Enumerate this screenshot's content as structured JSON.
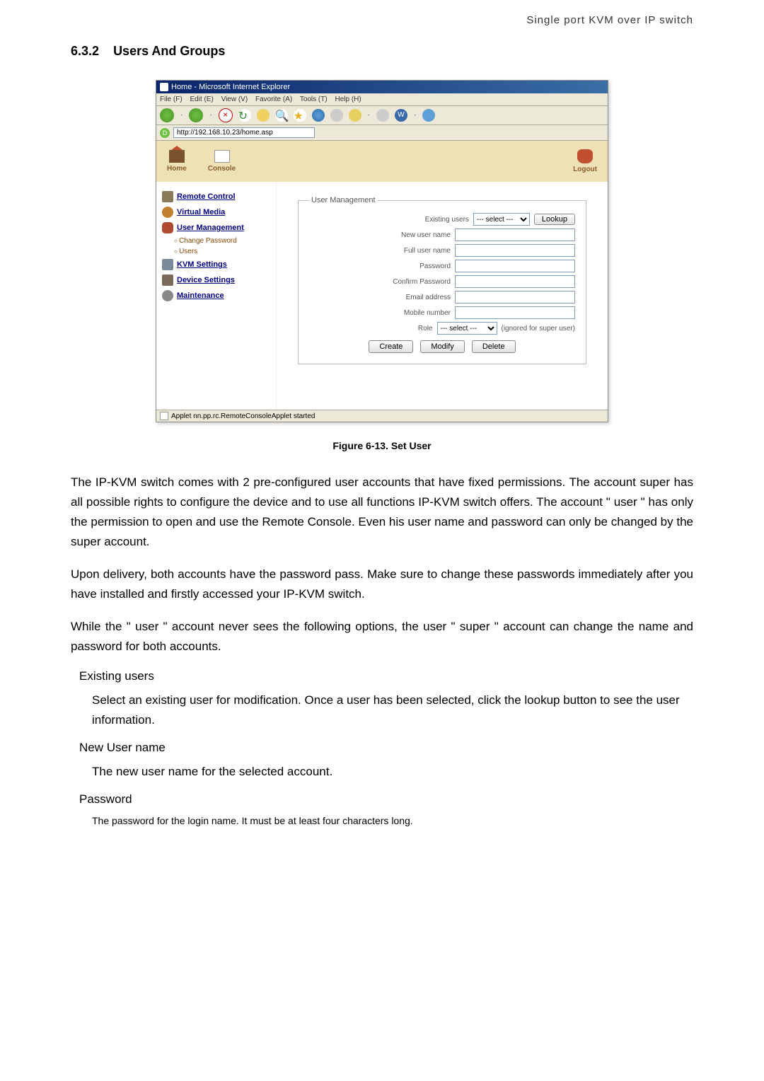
{
  "page": {
    "header": "Single port KVM over IP switch",
    "section_number": "6.3.2",
    "section_title": "Users And Groups"
  },
  "screenshot": {
    "titlebar": "Home - Microsoft Internet Explorer",
    "menubar": {
      "file": "File (F)",
      "edit": "Edit (E)",
      "view": "View (V)",
      "favorite": "Favorite (A)",
      "tools": "Tools (T)",
      "help": "Help (H)"
    },
    "address_url": "http://192.168.10.23/home.asp",
    "app_header": {
      "home": "Home",
      "console": "Console",
      "logout": "Logout"
    },
    "sidebar": {
      "remote_control": "Remote Control",
      "virtual_media": "Virtual Media",
      "user_management": "User Management",
      "change_password": "Change Password",
      "users": "Users",
      "kvm_settings": "KVM Settings",
      "device_settings": "Device Settings",
      "maintenance": "Maintenance"
    },
    "form": {
      "legend": "User Management",
      "existing_users_label": "Existing users",
      "existing_users_value": "--- select ---",
      "lookup_btn": "Lookup",
      "new_user_label": "New user name",
      "full_user_label": "Full user name",
      "password_label": "Password",
      "confirm_password_label": "Confirm Password",
      "email_label": "Email address",
      "mobile_label": "Mobile number",
      "role_label": "Role",
      "role_value": "--- select ---",
      "role_note": "(ignored for super user)",
      "create_btn": "Create",
      "modify_btn": "Modify",
      "delete_btn": "Delete"
    },
    "statusbar": "Applet nn.pp.rc.RemoteConsoleApplet started"
  },
  "figure_caption": "Figure 6-13. Set User",
  "paragraphs": {
    "p1": "The IP-KVM switch comes with 2 pre-configured user accounts that have fixed permissions. The account super has all possible rights to configure the device and to use all functions IP-KVM switch offers. The account \" user \" has only the permission to open and use the Remote Console. Even his user name and password can only be changed by the super account.",
    "p2": "Upon delivery, both accounts have the password pass. Make sure to change these passwords immediately after you have installed and firstly accessed your IP-KVM switch.",
    "p3": "While the \" user \" account never sees the following options, the user \" super \" account can change the name and password for both accounts."
  },
  "terms": {
    "existing_users": "Existing users",
    "existing_users_desc": "Select an existing user for modification. Once a user has been selected, click the lookup button to see the user information.",
    "new_user_name": "New User name",
    "new_user_name_desc": "The new user name for the selected account.",
    "password": "Password",
    "password_desc": "The password for the login name. It must be at least four characters long."
  }
}
